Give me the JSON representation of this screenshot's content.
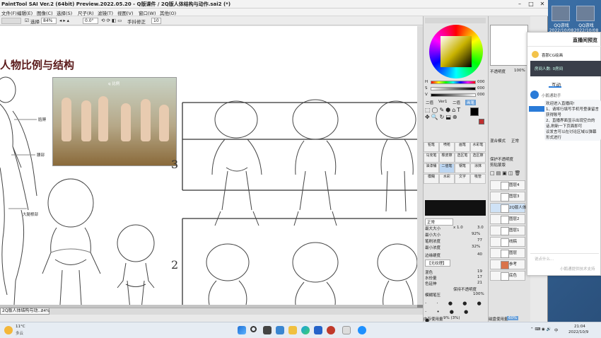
{
  "window": {
    "title": "PaintTool SAI Ver.2 (64bit) Preview.2022.05.20 - Q版课件 / 2Q版人体结构与动作.sai2 (*)",
    "minimize": "–",
    "maximize": "□",
    "close": "✕"
  },
  "menu": [
    "文件(F)",
    "编辑(E)",
    "图像(C)",
    "选择(S)",
    "尺子(R)",
    "滤镜(T)",
    "视图(V)",
    "窗口(W)",
    "其他(O)"
  ],
  "toolbar": {
    "select_label": "选择",
    "zoom": "84%",
    "angle": "0.0°",
    "hand_label": "手抖修正",
    "hand_value": "10"
  },
  "canvas": {
    "heading": "人物比例与结构",
    "photo_label": "q 比例",
    "labels": [
      "胳膊",
      "腰部",
      "大腿根部"
    ],
    "row_numbers": [
      "3",
      "2"
    ],
    "doc_tab": "2Q版人体结构与动...",
    "doc_zoom": "84%"
  },
  "color_panel": {
    "rgb_labels": [
      "H",
      "S",
      "V"
    ],
    "rgb_values": [
      "000",
      "000",
      "000"
    ]
  },
  "brush": {
    "tabs": [
      "二值",
      "Ver1",
      "二值",
      "画笔"
    ],
    "tool_rows": [
      [
        "铅笔",
        "喷枪",
        "画笔",
        "水彩笔"
      ],
      [
        "马克笔",
        "橡皮擦",
        "选区笔",
        "选区擦"
      ],
      [
        "油漆桶",
        "二值笔",
        "钢笔",
        "涂抹"
      ],
      [
        "模糊",
        "水彩",
        "文字",
        "吸管"
      ]
    ],
    "mode": "正常",
    "size_label": "最大大小",
    "size_value": "3.0",
    "size_mult": "x 1.0",
    "min_size_label": "最小大小",
    "min_size_value": "92%",
    "density_label": "笔刷浓度",
    "density_value": "77",
    "min_density_label": "最小浓度",
    "min_density_value": "32%",
    "edge_label": "边缘硬度",
    "edge_value": "40",
    "texture_label": "【无纹理】",
    "blend_label": "混色",
    "blend_value": "19",
    "water_label": "水份量",
    "water_value": "17",
    "hold_label": "色延伸",
    "hold_value": "21",
    "keep_opacity_label": "保持不透明度",
    "pressure_label": "模糊笔压",
    "pressure_value": "100%",
    "scroll_percent": 0.3
  },
  "layer_panel": {
    "opacity_label": "不透明度",
    "opacity_value": "100%",
    "blend_mode_label": "混合模式",
    "blend_mode": "正常",
    "protect_label": "保护不透明度",
    "clip_label": "剪贴蒙版",
    "layers": [
      "图层4",
      "图层3",
      "2Q版人体",
      "图层2",
      "图层1",
      "线稿",
      "图层",
      "参考",
      "底色"
    ],
    "layer_opacity": "100%"
  },
  "status": {
    "memory_label": "内存使用量",
    "memory_value": "9% (3%)",
    "disk_label": "磁盘使用量",
    "disk_value": "60%"
  },
  "live_panel": {
    "title": "直播间预览",
    "host": "喜那CG绘画",
    "room_label": "房间人数: 0房间",
    "interact": "互动",
    "assistant": "小鹅通助手",
    "welcome": "欢迎进入直播间!",
    "tip1": "1、请将行填写手机号登录留言获得账号",
    "tip2": "2、直播界面显示出现空白的话,刷新一下页面即可",
    "tip3": "议发言可以在讨论区域以弹幕形式进行",
    "input_placeholder": "说点什么...",
    "footer": "小鹅通提供技术支持"
  },
  "desktop_icons": [
    "QQ游戏2022/10/08",
    "QQ游戏2022/10/08"
  ],
  "taskbar": {
    "weather_temp": "11°C",
    "weather_desc": "多云",
    "time": "21:04",
    "date": "2022/10/9",
    "lang": "中"
  },
  "colors": {
    "accent": "#6aa0d8",
    "heading": "#5a1a1a",
    "primary_color": "#000000",
    "live_accent": "#2a7bd8"
  }
}
